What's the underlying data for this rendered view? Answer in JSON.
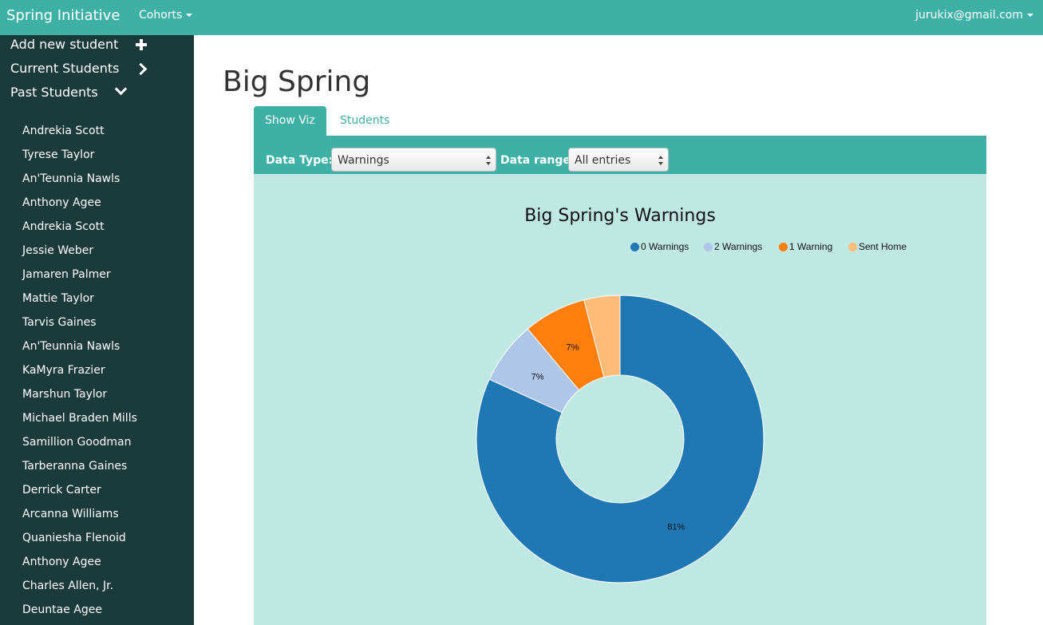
{
  "navbar": {
    "brand": "Spring Initiative",
    "cohorts_label": "Cohorts",
    "user_email": "jurukix@gmail.com"
  },
  "sidebar": {
    "add_new": "Add new student",
    "current": "Current Students",
    "past": "Past Students",
    "students": [
      "Andrekia Scott",
      "Tyrese Taylor",
      "An'Teunnia Nawls",
      "Anthony Agee",
      "Andrekia Scott",
      "Jessie Weber",
      "Jamaren Palmer",
      "Mattie Taylor",
      "Tarvis Gaines",
      "An'Teunnia Nawls",
      "KaMyra Frazier",
      "Marshun Taylor",
      "Michael Braden Mills",
      "Samillion Goodman",
      "Tarberanna Gaines",
      "Derrick Carter",
      "Arcanna Williams",
      "Quaniesha Flenoid",
      "Anthony Agee",
      "Charles Allen, Jr.",
      "Deuntae Agee"
    ]
  },
  "main": {
    "title": "Big Spring",
    "tabs": [
      {
        "label": "Show Viz"
      },
      {
        "label": "Students"
      }
    ],
    "controls": {
      "data_type_label": "Data Type:",
      "data_type_value": "Warnings",
      "data_range_label": "Data range",
      "data_range_value": "All entries"
    }
  },
  "colors": {
    "accent": "#3fb0a5",
    "sidebar": "#1b3a3a",
    "viz_bg": "#bfe8e3"
  },
  "chart_data": {
    "type": "pie",
    "title": "Big Spring's Warnings",
    "legend_position": "top-right",
    "donut": true,
    "categories": [
      "0 Warnings",
      "2 Warnings",
      "1 Warning",
      "Sent Home"
    ],
    "values": [
      81,
      7,
      7,
      4
    ],
    "labels": [
      "81%",
      "7%",
      "7%",
      ""
    ],
    "colors": [
      "#1f77b4",
      "#aec7e8",
      "#ff7f0e",
      "#ffbb78"
    ]
  }
}
